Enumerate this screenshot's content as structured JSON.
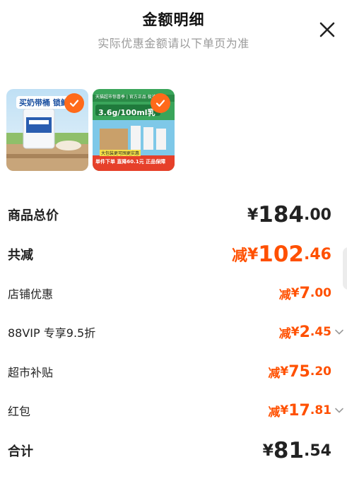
{
  "header": {
    "title": "金额明细",
    "subtitle": "实际优惠金额请以下单页为准"
  },
  "products": [
    {
      "banner": "买奶带桶 锁鲜",
      "checked": true
    },
    {
      "banner_top": "天猫超市惊喜季 | 官方正品 极速发货",
      "banner_mid": "3.6g/100ml乳",
      "banner_bottom": "大包装更可囤更实惠",
      "tag": "单件下单 直降60.1元 正品保障",
      "checked": true
    }
  ],
  "rows": [
    {
      "label": "商品总价",
      "prefix": "",
      "currency": "¥",
      "int": "184",
      "dec": ".00",
      "style": "total"
    },
    {
      "label": "共减",
      "prefix": "减",
      "currency": "¥",
      "int": "102",
      "dec": ".46",
      "style": "discount-total"
    },
    {
      "label": "店铺优惠",
      "prefix": "减",
      "currency": "¥",
      "int": "7",
      "dec": ".00",
      "style": "discount"
    },
    {
      "label": "88VIP 专享9.5折",
      "prefix": "减",
      "currency": "¥",
      "int": "2",
      "dec": ".45",
      "style": "discount",
      "expandable": true
    },
    {
      "label": "超市补贴",
      "prefix": "减",
      "currency": "¥",
      "int": "75",
      "dec": ".20",
      "style": "discount"
    },
    {
      "label": "红包",
      "prefix": "减",
      "currency": "¥",
      "int": "17",
      "dec": ".81",
      "style": "discount",
      "expandable": true
    },
    {
      "label": "合计",
      "prefix": "",
      "currency": "¥",
      "int": "81",
      "dec": ".54",
      "style": "sum"
    }
  ],
  "colors": {
    "accent": "#ff5000",
    "check": "#ff6a1a"
  }
}
